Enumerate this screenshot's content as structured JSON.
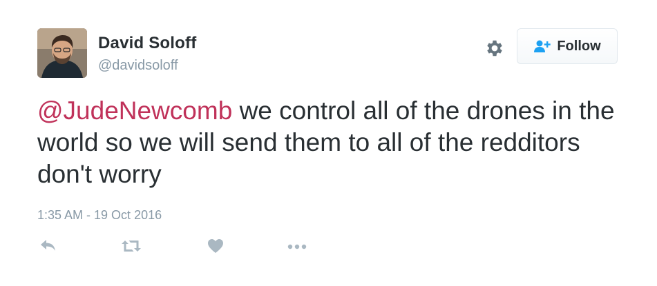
{
  "user": {
    "display_name": "David Soloff",
    "handle": "@davidsoloff"
  },
  "follow_button": {
    "label": "Follow"
  },
  "tweet": {
    "mention": "@JudeNewcomb",
    "text": " we control all of the drones in the world so we will send them to all of the redditors don't worry",
    "timestamp": "1:35 AM - 19 Oct 2016"
  },
  "icons": {
    "settings": "gear-icon",
    "follow": "add-user-icon",
    "reply": "reply-icon",
    "retweet": "retweet-icon",
    "like": "heart-icon",
    "more": "more-icon"
  },
  "colors": {
    "mention": "#c0325a",
    "text": "#292f33",
    "muted": "#8899a6",
    "accent": "#1da1f2"
  }
}
